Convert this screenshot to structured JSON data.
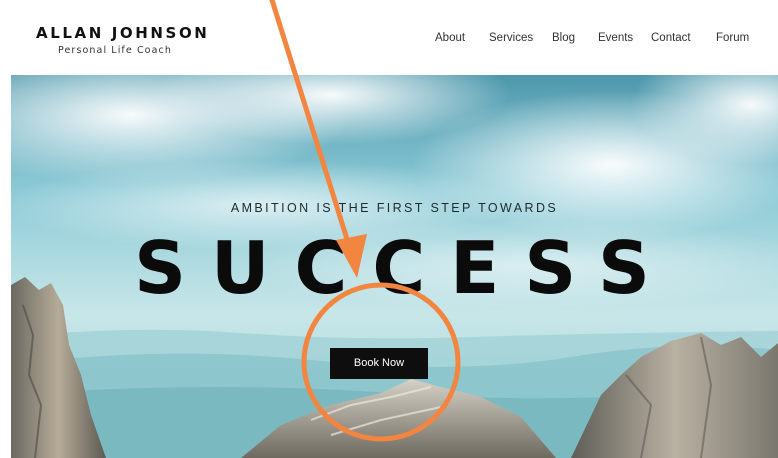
{
  "header": {
    "brand_name": "ALLAN JOHNSON",
    "tagline": "Personal Life Coach"
  },
  "nav": {
    "items": [
      {
        "label": "About"
      },
      {
        "label": "Services"
      },
      {
        "label": "Blog"
      },
      {
        "label": "Events"
      },
      {
        "label": "Contact"
      },
      {
        "label": "Forum"
      }
    ]
  },
  "hero": {
    "subtitle": "AMBITION IS THE FIRST STEP TOWARDS",
    "title": "SUCCESS",
    "cta_label": "Book Now"
  },
  "annotation": {
    "color": "#f2853f",
    "shapes": [
      "arrow-icon",
      "circle-highlight"
    ]
  }
}
